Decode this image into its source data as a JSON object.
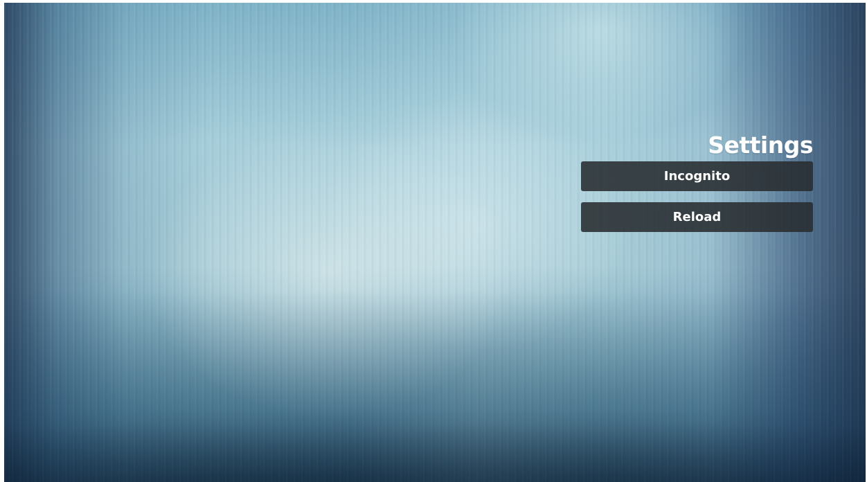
{
  "settings": {
    "title": "Settings",
    "items": [
      {
        "label": "Incognito"
      },
      {
        "label": "Reload"
      }
    ]
  },
  "colors": {
    "button_background": "#2c3034",
    "text": "#ffffff",
    "background_light": "#a9d0dc",
    "background_dark": "#2c4f68"
  }
}
